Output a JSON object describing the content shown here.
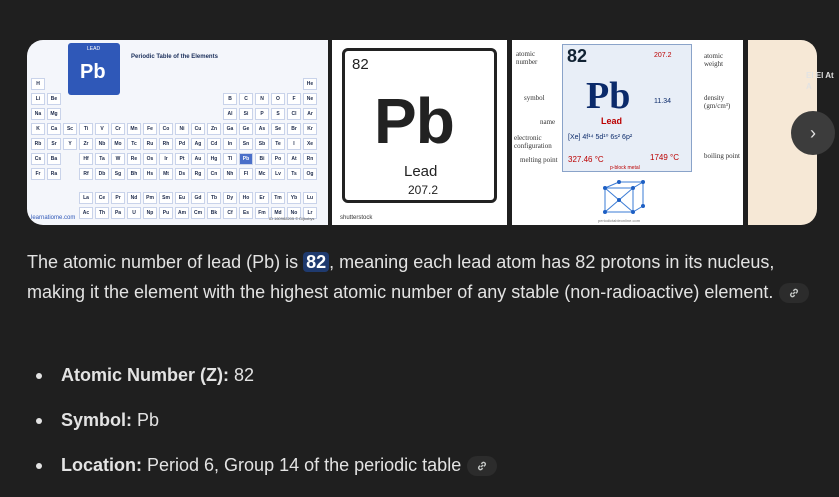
{
  "carousel": {
    "tile1": {
      "lead_label": "LEAD",
      "symbol": "Pb",
      "title": "Periodic Table of the Elements",
      "brand": "learnatiome.com",
      "footer": "ID 160968205 © Dijkobys",
      "elements": [
        "H",
        "He",
        "Li",
        "Be",
        "B",
        "C",
        "N",
        "O",
        "F",
        "Ne",
        "Na",
        "Mg",
        "Al",
        "Si",
        "P",
        "S",
        "Cl",
        "Ar",
        "K",
        "Ca",
        "Sc",
        "Ti",
        "V",
        "Cr",
        "Mn",
        "Fe",
        "Co",
        "Ni",
        "Cu",
        "Zn",
        "Ga",
        "Ge",
        "As",
        "Se",
        "Br",
        "Kr",
        "Rb",
        "Sr",
        "Y",
        "Zr",
        "Nb",
        "Mo",
        "Tc",
        "Ru",
        "Rh",
        "Pd",
        "Ag",
        "Cd",
        "In",
        "Sn",
        "Sb",
        "Te",
        "I",
        "Xe",
        "Cs",
        "Ba",
        "Hf",
        "Ta",
        "W",
        "Re",
        "Os",
        "Ir",
        "Pt",
        "Au",
        "Hg",
        "Tl",
        "Pb",
        "Bi",
        "Po",
        "At",
        "Rn",
        "Fr",
        "Ra",
        "Rf",
        "Db",
        "Sg",
        "Bh",
        "Hs",
        "Mt",
        "Ds",
        "Rg",
        "Cn",
        "Nh",
        "Fl",
        "Mc",
        "Lv",
        "Ts",
        "Og",
        "La",
        "Ce",
        "Pr",
        "Nd",
        "Pm",
        "Sm",
        "Eu",
        "Gd",
        "Tb",
        "Dy",
        "Ho",
        "Er",
        "Tm",
        "Yb",
        "Lu",
        "Ac",
        "Th",
        "Pa",
        "U",
        "Np",
        "Pu",
        "Am",
        "Cm",
        "Bk",
        "Cf",
        "Es",
        "Fm",
        "Md",
        "No",
        "Lr"
      ]
    },
    "tile2": {
      "number": "82",
      "symbol": "Pb",
      "name": "Lead",
      "weight": "207.2",
      "watermark": "shutterstock"
    },
    "tile3": {
      "number": "82",
      "atomic_weight": "207.2",
      "symbol": "Pb",
      "density": "11.34",
      "name": "Lead",
      "config": "[Xe] 4f¹⁴ 5d¹⁰ 6s² 6p²",
      "melting": "327.46 °C",
      "boiling": "1749 °C",
      "block": "p-block metal",
      "labels": {
        "atomic_number": "atomic number",
        "symbol": "symbol",
        "name": "name",
        "electronic_configuration": "electronic configuration",
        "melting_point": "melting point",
        "atomic_weight": "atomic weight",
        "density": "density (gm/cm³)",
        "boiling_point": "boiling point"
      },
      "source": "periodictableonline.com"
    },
    "next_icon": "›",
    "edge_text": "El El At A"
  },
  "answer": {
    "part1": "The atomic number of lead (Pb) is ",
    "highlight": "82",
    "part2": ", meaning each lead atom has 82 protons in its nucleus, making it the element with the highest atomic number of any stable (non-radioactive) element."
  },
  "bullets": [
    {
      "label": "Atomic Number (Z):",
      "value": " 82"
    },
    {
      "label": "Symbol:",
      "value": " Pb"
    },
    {
      "label": "Location:",
      "value": " Period 6, Group 14 of the periodic table"
    }
  ],
  "colors": {
    "background": "#1f1f1f",
    "highlight": "#1f3a6e",
    "text": "#e3e3e3"
  }
}
